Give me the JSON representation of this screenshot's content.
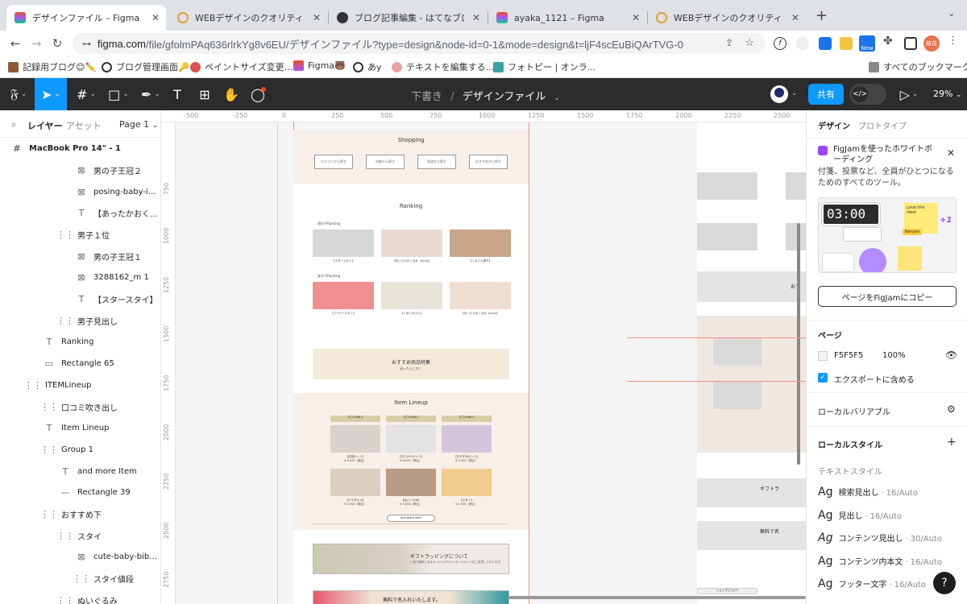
{
  "browser": {
    "tabs": [
      {
        "title": "デザインファイル – Figma",
        "active": true
      },
      {
        "title": "WEBデザインのクオリティを上げる"
      },
      {
        "title": "ブログ記事編集 - はてなブログ"
      },
      {
        "title": "ayaka_1121 – Figma"
      },
      {
        "title": "WEBデザインのクオリティを上げる"
      }
    ],
    "url_domain": "figma.com",
    "url_path": "/file/gfolmPAq636rlrkYg8v6EU/デザインファイル?type=design&node-id=0-1&mode=design&t=ljF4scEuBiQArTVG-0",
    "profile_initials": "綾花",
    "ext_new_badge": "New",
    "bookmarks": [
      "記録用ブログ😊✏️",
      "ブログ管理画面🔑",
      "ペイントサイズ変更...",
      "Figma🐻",
      "あy",
      "テキストを編集する...",
      "フォトピー | オンラ..."
    ],
    "all_bookmarks": "すべてのブックマーク"
  },
  "figma": {
    "breadcrumb_draft": "下書き",
    "breadcrumb_sep": "/",
    "file_name": "デザインファイル",
    "share_label": "共有",
    "zoom": "29%",
    "left_panel": {
      "tab_layers": "レイヤー",
      "tab_assets": "アセット",
      "page": "Page 1",
      "root_frame": "MacBook Pro 14\" - 1",
      "layers": [
        {
          "name": "男の子王冠２",
          "type": "image",
          "indent": 3
        },
        {
          "name": "posing-baby-in-...",
          "type": "image",
          "indent": 3
        },
        {
          "name": "【あったかおく...",
          "type": "text",
          "indent": 3
        },
        {
          "name": "男子１位",
          "type": "group",
          "indent": 2
        },
        {
          "name": "男の子王冠１",
          "type": "image",
          "indent": 3
        },
        {
          "name": "3288162_m 1",
          "type": "image",
          "indent": 3
        },
        {
          "name": "【スタースタイ】",
          "type": "text",
          "indent": 3
        },
        {
          "name": "男子見出し",
          "type": "group",
          "indent": 2
        },
        {
          "name": "Ranking",
          "type": "text",
          "indent": 1
        },
        {
          "name": "Rectangle 65",
          "type": "rect",
          "indent": 1
        },
        {
          "name": "ITEMLineup",
          "type": "group",
          "indent": 0
        },
        {
          "name": "口コミ吹き出し",
          "type": "group",
          "indent": 1
        },
        {
          "name": "Item Lineup",
          "type": "text",
          "indent": 1
        },
        {
          "name": "Group 1",
          "type": "group",
          "indent": 1
        },
        {
          "name": "and more Item",
          "type": "text",
          "indent": 2
        },
        {
          "name": "Rectangle 39",
          "type": "line",
          "indent": 2
        },
        {
          "name": "おすすめ下",
          "type": "group",
          "indent": 1
        },
        {
          "name": "スタイ",
          "type": "group",
          "indent": 2
        },
        {
          "name": "cute-baby-bibs-...",
          "type": "image",
          "indent": 3
        },
        {
          "name": "スタイ値段",
          "type": "group",
          "indent": 3
        },
        {
          "name": "ぬいぐるみ",
          "type": "group",
          "indent": 2
        }
      ]
    },
    "ruler_top": [
      "-500",
      "-250",
      "0",
      "250",
      "500",
      "750",
      "1000",
      "1250",
      "1500",
      "1750",
      "2000",
      "2250",
      "2500"
    ],
    "ruler_left": [
      "750",
      "1000",
      "1250",
      "1500",
      "1750",
      "2000",
      "2250",
      "2500",
      "2750"
    ],
    "design": {
      "shopping_title": "Shopping",
      "shopping_buttons": [
        "カテゴリから探す",
        "年齢から探す",
        "用途から探す",
        "おすすめから探す"
      ],
      "ranking_title": "Ranking",
      "ranking_boy": "男の子Ranking",
      "ranking_girl": "女の子Ranking",
      "boy_items": [
        "【スタースタイ】",
        "【あったかおくるみ（blue)】",
        "【くまさん帽子】"
      ],
      "girl_items": [
        "【フラワースタイ】",
        "【リボンタオル】",
        "【あったかおくるみ（pink)】"
      ],
      "feature_title": "おすすめ商品特集",
      "feature_sub": "迷ったらこれ！",
      "lineup_title": "Item Lineup",
      "lineup_badges": [
        "口コミNo.1",
        "口コミNo.2",
        "口コミNo.3"
      ],
      "lineup_items": [
        {
          "name": "【足袋セット】",
          "price": "¥ 5,000（税込）"
        },
        {
          "name": "【おでかけセット】",
          "price": "¥ 6,000（税込）"
        },
        {
          "name": "【おやすみセット】",
          "price": "¥ 5,500（税込）"
        },
        {
          "name": "【バスタオル】",
          "price": "¥ 2,000（税込）"
        },
        {
          "name": "【ぬいぐるみ】",
          "price": "¥ 3,000（税込）"
        },
        {
          "name": "【スタイ】",
          "price": "¥ 1,500（税込）"
        }
      ],
      "and_more": "and more Item",
      "gift_title": "ギフトラッピングについて",
      "gift_sub": "一目で無料になるラッピングやメッセージカードをご用意しております。",
      "free_title": "無料で名入れいたします。",
      "side_free": "無料で名",
      "side_gift": "ギフトラ",
      "side_shop": "ショップについて",
      "side_osusume": "おす"
    },
    "right_panel": {
      "tab_design": "デザイン",
      "tab_prototype": "プロトタイプ",
      "promo_title": "FigJamを使ったホワイトボーディング",
      "promo_body": "付箋、投票など、全員がひとつになるためのすべてのツール。",
      "promo_timer": "03:00",
      "promo_sticky": "Love this idea!",
      "promo_name": "Kenyon",
      "promo_plus": "+1",
      "promo_button": "ページをFigJamにコピー",
      "page_heading": "ページ",
      "page_color": "F5F5F5",
      "page_opacity": "100%",
      "export_label": "エクスポートに含める",
      "local_variables": "ローカルバリアブル",
      "local_styles": "ローカルスタイル",
      "text_styles_heading": "テキストスタイル",
      "text_styles": [
        {
          "name": "検索見出し",
          "meta": "16/Auto"
        },
        {
          "name": "見出し",
          "meta": "16/Auto"
        },
        {
          "name": "コンテンツ見出し",
          "meta": "30/Auto"
        },
        {
          "name": "コンテンツ内本文",
          "meta": "16/Auto"
        },
        {
          "name": "フッター文字",
          "meta": "16/Auto"
        }
      ],
      "help": "?"
    }
  },
  "colors": {
    "toolbar": "#2c2c2c",
    "accent": "#0d99ff",
    "canvas": "#f5f5f5",
    "frame_bg": "#f7efe8",
    "guide": "#ff8a80"
  }
}
